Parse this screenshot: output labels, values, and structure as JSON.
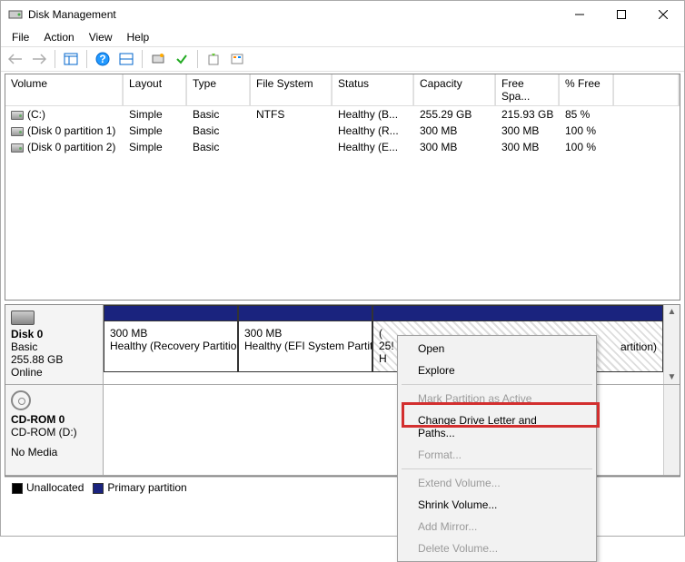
{
  "window": {
    "title": "Disk Management"
  },
  "menu": {
    "file": "File",
    "action": "Action",
    "view": "View",
    "help": "Help"
  },
  "columns": {
    "volume": "Volume",
    "layout": "Layout",
    "type": "Type",
    "fs": "File System",
    "status": "Status",
    "capacity": "Capacity",
    "free": "Free Spa...",
    "pct": "% Free"
  },
  "volumes": [
    {
      "name": "(C:)",
      "layout": "Simple",
      "type": "Basic",
      "fs": "NTFS",
      "status": "Healthy (B...",
      "capacity": "255.29 GB",
      "free": "215.93 GB",
      "pct": "85 %"
    },
    {
      "name": "(Disk 0 partition 1)",
      "layout": "Simple",
      "type": "Basic",
      "fs": "",
      "status": "Healthy (R...",
      "capacity": "300 MB",
      "free": "300 MB",
      "pct": "100 %"
    },
    {
      "name": "(Disk 0 partition 2)",
      "layout": "Simple",
      "type": "Basic",
      "fs": "",
      "status": "Healthy (E...",
      "capacity": "300 MB",
      "free": "300 MB",
      "pct": "100 %"
    }
  ],
  "disk0": {
    "label": "Disk 0",
    "kind": "Basic",
    "size": "255.88 GB",
    "state": "Online",
    "p1": {
      "size": "300 MB",
      "desc": "Healthy (Recovery Partition"
    },
    "p2": {
      "size": "300 MB",
      "desc": "Healthy (EFI System Partiti"
    },
    "p3": {
      "name": "(",
      "size": "25!",
      "desc": "H"
    },
    "p3tail": "artition)"
  },
  "cdrom": {
    "label": "CD-ROM 0",
    "sub": "CD-ROM (D:)",
    "state": "No Media"
  },
  "legend": {
    "unalloc": "Unallocated",
    "primary": "Primary partition"
  },
  "ctx": {
    "open": "Open",
    "explore": "Explore",
    "mark": "Mark Partition as Active",
    "change": "Change Drive Letter and Paths...",
    "format": "Format...",
    "extend": "Extend Volume...",
    "shrink": "Shrink Volume...",
    "mirror": "Add Mirror...",
    "delete": "Delete Volume..."
  }
}
